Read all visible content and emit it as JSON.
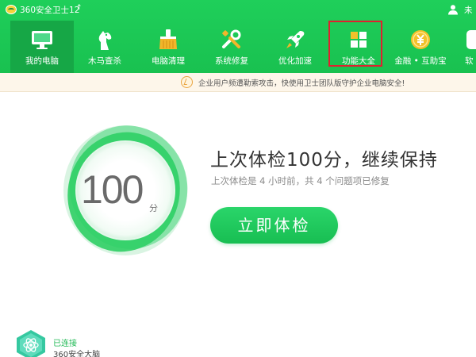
{
  "app": {
    "title": "360安全卫士12",
    "update_arrow": "↑",
    "user_text": "未"
  },
  "tabs": [
    {
      "label": "我的电脑",
      "icon": "monitor-icon",
      "active": true
    },
    {
      "label": "木马查杀",
      "icon": "horse-icon",
      "active": false
    },
    {
      "label": "电脑清理",
      "icon": "broom-icon",
      "active": false
    },
    {
      "label": "系统修复",
      "icon": "tools-icon",
      "active": false
    },
    {
      "label": "优化加速",
      "icon": "rocket-icon",
      "active": false
    },
    {
      "label": "功能大全",
      "icon": "grid-icon",
      "active": false
    },
    {
      "label": "金融 • 互助宝",
      "icon": "coin-icon",
      "active": false
    },
    {
      "label": "软",
      "icon": "software-icon",
      "active": false
    }
  ],
  "notice": {
    "icon": "shield-alert-icon",
    "text": "企业用户频遭勒索攻击，快使用卫士团队版守护企业电脑安全!"
  },
  "score": {
    "value": "100",
    "unit": "分"
  },
  "status": {
    "headline": "上次体检100分，继续保持",
    "detail": "上次体检是 4 小时前，共 4 个问题项已修复"
  },
  "action": {
    "scan_label": "立即体检"
  },
  "brain": {
    "status": "已连接",
    "name": "360安全大脑"
  },
  "colors": {
    "header_green": "#1fcf5a",
    "active_tab": "#16a746",
    "highlight_red": "#e0202f",
    "button_green": "#18be52"
  }
}
